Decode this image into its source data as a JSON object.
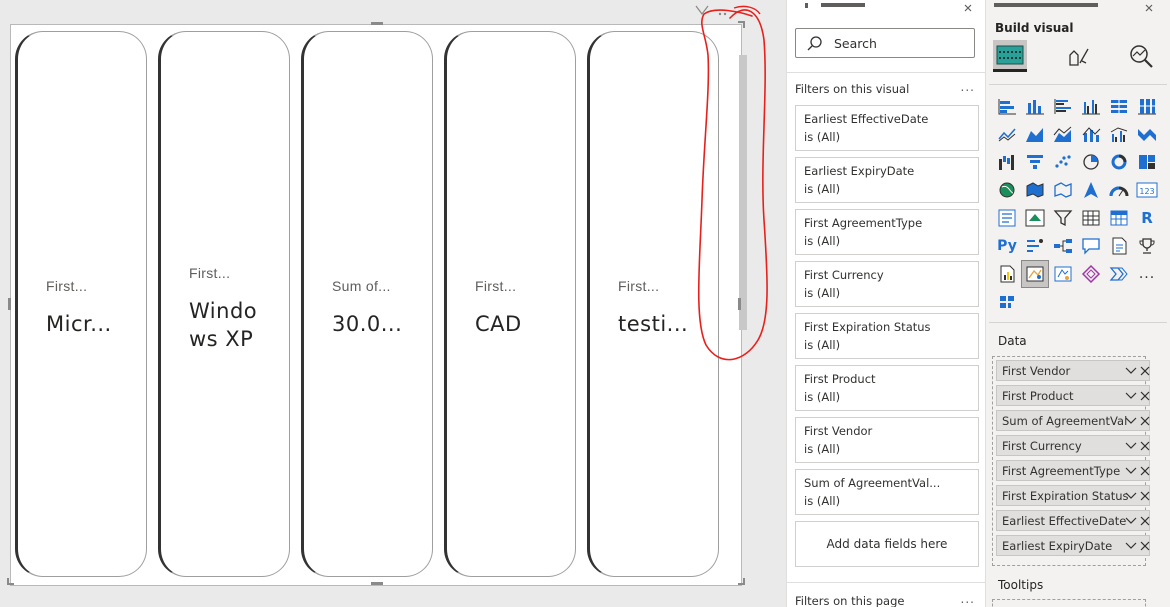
{
  "cards": [
    {
      "label": "First...",
      "value": "Micr..."
    },
    {
      "label": "First...",
      "value": "Windo\nws XP"
    },
    {
      "label": "Sum of...",
      "value": "30.0..."
    },
    {
      "label": "First...",
      "value": "CAD"
    },
    {
      "label": "First...",
      "value": "testi..."
    }
  ],
  "filters": {
    "search_placeholder": "Search",
    "on_this_visual_title": "Filters on this visual",
    "more_label": "...",
    "items": [
      {
        "name": "Earliest EffectiveDate",
        "value": "is (All)"
      },
      {
        "name": "Earliest ExpiryDate",
        "value": "is (All)"
      },
      {
        "name": "First AgreementType",
        "value": "is (All)"
      },
      {
        "name": "First Currency",
        "value": "is (All)"
      },
      {
        "name": "First Expiration Status",
        "value": "is (All)"
      },
      {
        "name": "First Product",
        "value": "is (All)"
      },
      {
        "name": "First Vendor",
        "value": "is (All)"
      },
      {
        "name": "Sum of AgreementVal...",
        "value": "is (All)"
      }
    ],
    "add_fields_label": "Add data fields here",
    "on_this_page_title": "Filters on this page"
  },
  "viz": {
    "build_visual_label": "Build visual",
    "data_label": "Data",
    "fields": [
      "First Vendor",
      "First Product",
      "Sum of AgreementVal...",
      "First Currency",
      "First AgreementType",
      "First Expiration Status",
      "Earliest EffectiveDate",
      "Earliest ExpiryDate"
    ],
    "tooltips_label": "Tooltips",
    "r_label": "R",
    "py_label": "Py",
    "num_label": "123",
    "more_icon": "..."
  },
  "colors": {
    "annotation": "#e8201c",
    "accent_blue": "#1f6fd1",
    "teal": "#2aa198"
  }
}
